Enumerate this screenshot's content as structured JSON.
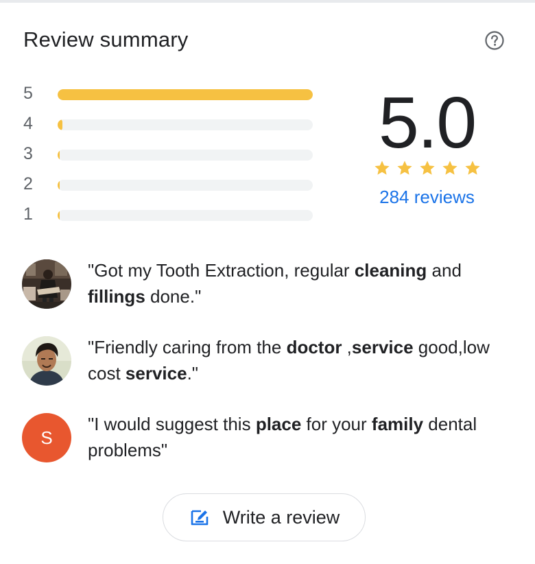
{
  "header": {
    "title": "Review summary",
    "help_icon": "help-circle-icon"
  },
  "histogram": [
    {
      "stars": "5",
      "fraction": 1.0
    },
    {
      "stars": "4",
      "fraction": 0.02
    },
    {
      "stars": "3",
      "fraction": 0.005
    },
    {
      "stars": "2",
      "fraction": 0.005
    },
    {
      "stars": "1",
      "fraction": 0.005
    }
  ],
  "summary": {
    "score": "5.0",
    "stars": 5,
    "star_color": "#f6c142",
    "reviews_link": "284 reviews",
    "link_color": "#1a73e8"
  },
  "reviews": [
    {
      "avatar": "photo-guitar-player",
      "parts": [
        {
          "t": "\"Got my Tooth Extraction, regular "
        },
        {
          "t": "cleaning",
          "b": true
        },
        {
          "t": " and "
        },
        {
          "t": "fillings",
          "b": true
        },
        {
          "t": " done.\""
        }
      ]
    },
    {
      "avatar": "photo-man-portrait",
      "parts": [
        {
          "t": "\"Friendly caring from the "
        },
        {
          "t": "doctor",
          "b": true
        },
        {
          "t": " ,"
        },
        {
          "t": "service",
          "b": true
        },
        {
          "t": " good,low cost "
        },
        {
          "t": "service",
          "b": true
        },
        {
          "t": ".\""
        }
      ]
    },
    {
      "avatar_letter": "S",
      "avatar_color": "#e8572f",
      "parts": [
        {
          "t": "\"I would suggest this "
        },
        {
          "t": "place",
          "b": true
        },
        {
          "t": " for your "
        },
        {
          "t": "family",
          "b": true
        },
        {
          "t": " dental problems\""
        }
      ]
    }
  ],
  "write_review": {
    "label": "Write a review",
    "icon": "edit-rectangle-icon"
  }
}
